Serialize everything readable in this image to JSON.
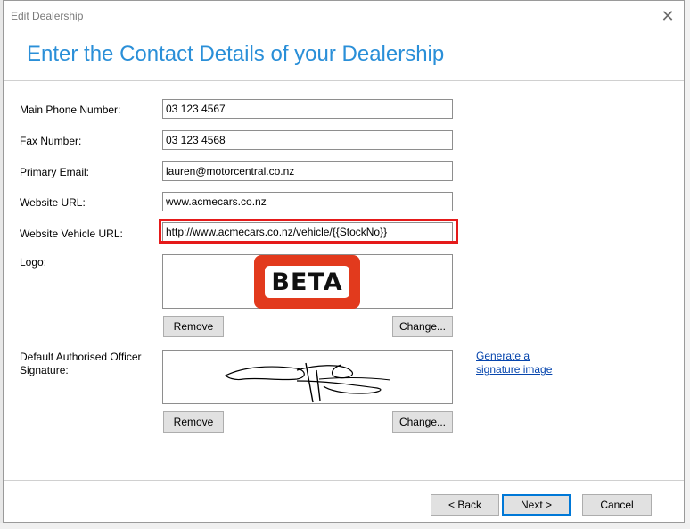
{
  "window": {
    "title": "Edit Dealership"
  },
  "heading": "Enter the Contact Details of your Dealership",
  "fields": {
    "main_phone": {
      "label": "Main Phone Number:",
      "value": "03 123 4567"
    },
    "fax": {
      "label": "Fax Number:",
      "value": "03 123 4568"
    },
    "email": {
      "label": "Primary Email:",
      "value": "lauren@motorcentral.co.nz"
    },
    "website": {
      "label": "Website URL:",
      "value": "www.acmecars.co.nz"
    },
    "vehicle_url": {
      "label": "Website Vehicle URL:",
      "value": "http://www.acmecars.co.nz/vehicle/{{StockNo}}"
    }
  },
  "logo": {
    "label": "Logo:",
    "badge_text": "BETA",
    "badge_color": "#e23a1d",
    "remove_label": "Remove",
    "change_label": "Change..."
  },
  "signature": {
    "label_line1": "Default Authorised Officer",
    "label_line2": "Signature:",
    "generate_link_line1": "Generate a",
    "generate_link_line2": "signature image",
    "remove_label": "Remove",
    "change_label": "Change..."
  },
  "footer": {
    "back_label": "< Back",
    "next_label": "Next >",
    "cancel_label": "Cancel"
  },
  "colors": {
    "heading": "#2a8fd8",
    "highlight": "#e51a1a",
    "link": "#0645ad"
  }
}
